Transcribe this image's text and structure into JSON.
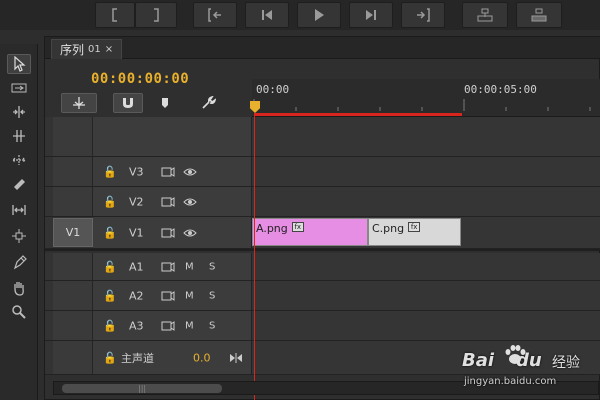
{
  "tab": {
    "name": "序列",
    "number": "01",
    "close": "×"
  },
  "timecode": "00:00:00:00",
  "ruler": {
    "start": "00:00",
    "mid": "00:00:05:00"
  },
  "tracks": {
    "video": [
      {
        "name": "V3"
      },
      {
        "name": "V2"
      },
      {
        "name": "V1",
        "source_patch": "V1"
      }
    ],
    "audio": [
      {
        "name": "A1",
        "mute": "M",
        "solo": "S"
      },
      {
        "name": "A2",
        "mute": "M",
        "solo": "S"
      },
      {
        "name": "A3",
        "mute": "M",
        "solo": "S"
      }
    ],
    "master": {
      "name": "主声道",
      "volume": "0.0"
    }
  },
  "clips": [
    {
      "label": "A.png",
      "fx": "fx",
      "color": "#e58ee3"
    },
    {
      "label": "C.png",
      "fx": "fx",
      "color": "#d8d8d8"
    }
  ],
  "watermark": {
    "brand": "Bai",
    "brand2": "du",
    "cn": "经验",
    "url": "jingyan.baidu.com"
  },
  "colors": {
    "timecode": "#e8b02d",
    "playhead": "#d8261f",
    "clip_a": "#e58ee3",
    "clip_c": "#d8d8d8"
  }
}
